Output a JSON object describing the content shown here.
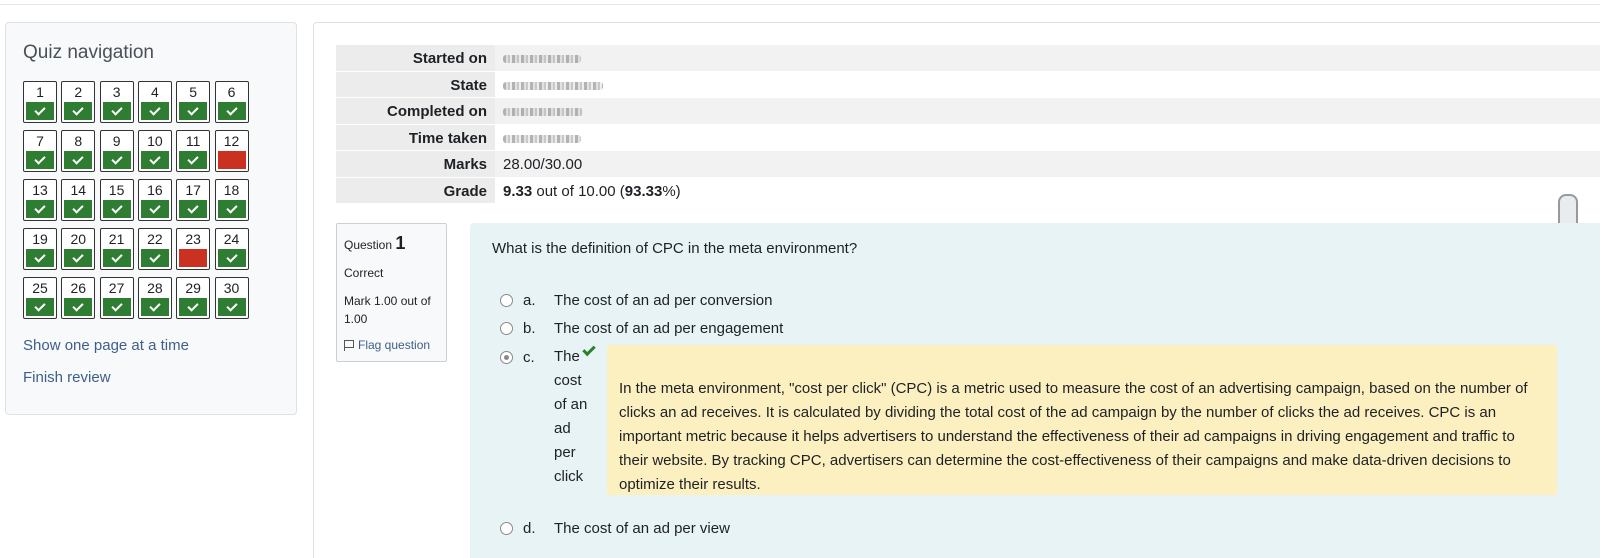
{
  "nav": {
    "title": "Quiz navigation",
    "questions": [
      {
        "n": "1",
        "s": "correct"
      },
      {
        "n": "2",
        "s": "correct"
      },
      {
        "n": "3",
        "s": "correct"
      },
      {
        "n": "4",
        "s": "correct"
      },
      {
        "n": "5",
        "s": "correct"
      },
      {
        "n": "6",
        "s": "correct"
      },
      {
        "n": "7",
        "s": "correct"
      },
      {
        "n": "8",
        "s": "correct"
      },
      {
        "n": "9",
        "s": "correct"
      },
      {
        "n": "10",
        "s": "correct"
      },
      {
        "n": "11",
        "s": "correct"
      },
      {
        "n": "12",
        "s": "incorrect"
      },
      {
        "n": "13",
        "s": "correct"
      },
      {
        "n": "14",
        "s": "correct"
      },
      {
        "n": "15",
        "s": "correct"
      },
      {
        "n": "16",
        "s": "correct"
      },
      {
        "n": "17",
        "s": "correct"
      },
      {
        "n": "18",
        "s": "correct"
      },
      {
        "n": "19",
        "s": "correct"
      },
      {
        "n": "20",
        "s": "correct"
      },
      {
        "n": "21",
        "s": "correct"
      },
      {
        "n": "22",
        "s": "correct"
      },
      {
        "n": "23",
        "s": "incorrect"
      },
      {
        "n": "24",
        "s": "correct"
      },
      {
        "n": "25",
        "s": "correct"
      },
      {
        "n": "26",
        "s": "correct"
      },
      {
        "n": "27",
        "s": "correct"
      },
      {
        "n": "28",
        "s": "correct"
      },
      {
        "n": "29",
        "s": "correct"
      },
      {
        "n": "30",
        "s": "correct"
      }
    ],
    "show_one_page": "Show one page at a time",
    "finish_review": "Finish review"
  },
  "summary": {
    "started_on_label": "Started on",
    "state_label": "State",
    "completed_on_label": "Completed on",
    "time_taken_label": "Time taken",
    "marks_label": "Marks",
    "marks_value": "28.00/30.00",
    "grade_label": "Grade",
    "grade_score": "9.33",
    "grade_out_of": " out of 10.00 (",
    "grade_percent": "93.33",
    "grade_close": "%)"
  },
  "question": {
    "label": "Question",
    "number": "1",
    "state": "Correct",
    "mark": "Mark 1.00 out of 1.00",
    "flag": "Flag question",
    "text": "What is the definition of CPC in the meta environment?",
    "options": [
      {
        "letter": "a.",
        "text": "The cost of an ad per conversion"
      },
      {
        "letter": "b.",
        "text": "The cost of an ad per engagement"
      },
      {
        "letter": "c.",
        "text": "The cost of an ad per click"
      },
      {
        "letter": "d.",
        "text": "The cost of an ad per view"
      }
    ],
    "feedback": "In the meta environment, \"cost per click\" (CPC) is a metric used to measure the cost of an advertising campaign, based on the number of clicks an ad receives. It is calculated by dividing the total cost of the ad campaign by the number of clicks the ad receives. CPC is an important metric because it helps advertisers to understand the effectiveness of their ad campaigns in driving engagement and traffic to their website. By tracking CPC, advertisers can determine the cost-effectiveness of their campaigns and make data-driven decisions to optimize their results."
  },
  "colors": {
    "correct": "#2e7d32",
    "incorrect": "#ca3120",
    "feedback_bg": "#fcefc0",
    "question_bg": "#e7f3f5"
  }
}
